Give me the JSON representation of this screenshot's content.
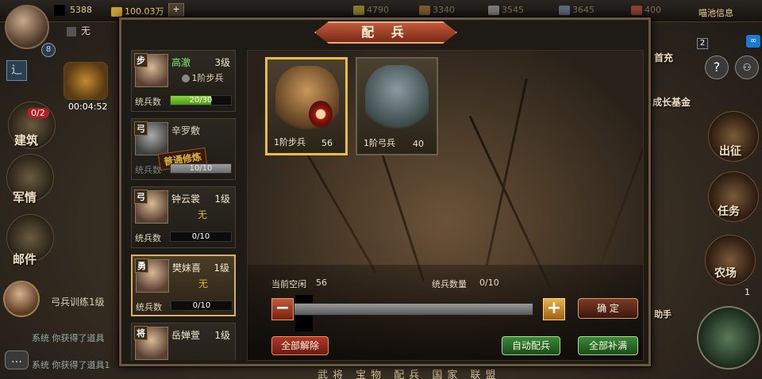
{
  "top": {
    "player_resource_1": "5388",
    "player_resource_2": "无",
    "resource_gold": "100.03万",
    "resource_food": "4790",
    "resource_wood": "3340",
    "resource_stone": "3545",
    "resource_iron": "3645",
    "resource_troops": "400",
    "player_level": "8",
    "event_label": "喵池信息"
  },
  "left_side": {
    "timer": "00:04:52",
    "badge": "0/2",
    "build_label": "建筑",
    "military_label": "军情",
    "mail_label": "邮件",
    "chat_title": "弓兵训练1级",
    "chat_msgs": [
      "系统 你获得了道具",
      "系统 你获得了道具1"
    ]
  },
  "right_side": {
    "first_charge": "首充",
    "growth_fund": "成长基金",
    "expedition": "出征",
    "task": "任务",
    "farm": "农场",
    "rank": "2",
    "help": "?",
    "assistant": "助手",
    "counter": "1"
  },
  "bottom_tabs": "武将 宝物 配兵 国家 联盟",
  "dialog": {
    "title": "配 兵",
    "generals": [
      {
        "tag": "步",
        "name": "高澈",
        "level": "3级",
        "troop": "1阶步兵",
        "troop_label": "统兵数",
        "troop_value": "20/30",
        "fill": 0.67,
        "active": false
      },
      {
        "tag": "弓",
        "name": "辛罗敷",
        "level": "",
        "troop": "",
        "troop_label": "统兵数",
        "troop_value": "10/10",
        "fill": 1.0,
        "status": "普通修炼"
      },
      {
        "tag": "弓",
        "name": "钟云裳",
        "level": "1级",
        "troop": "无",
        "troop_label": "统兵数",
        "troop_value": "0/10",
        "fill": 0
      },
      {
        "tag": "勇",
        "name": "樊妹喜",
        "level": "1级",
        "troop": "无",
        "troop_label": "统兵数",
        "troop_value": "0/10",
        "fill": 0,
        "active": true
      },
      {
        "tag": "将",
        "name": "岳婵萱",
        "level": "1级"
      }
    ],
    "troop_types": [
      {
        "name": "1阶步兵",
        "count": "56",
        "active": true
      },
      {
        "name": "1阶弓兵",
        "count": "40",
        "active": false
      }
    ],
    "idle_label": "当前空闲",
    "idle_value": "56",
    "command_label": "统兵数量",
    "command_value": "0/10",
    "minus": "−",
    "plus": "+",
    "confirm": "确 定",
    "release_all": "全部解除",
    "auto_assign": "自动配兵",
    "fill_all": "全部补满"
  }
}
